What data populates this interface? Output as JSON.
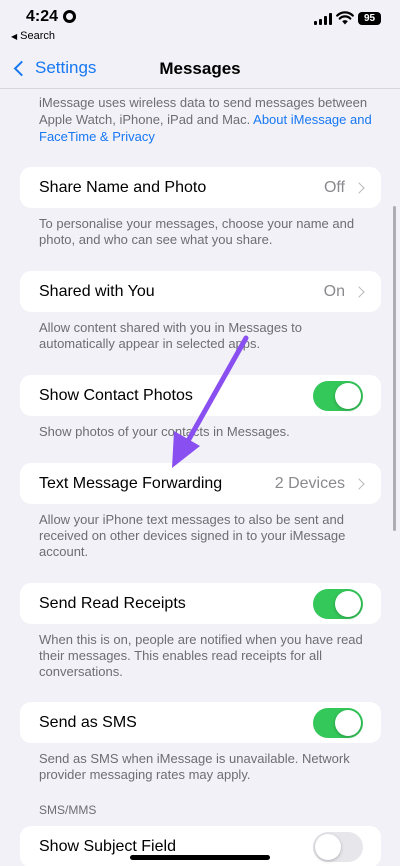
{
  "status_bar": {
    "time": "4:24",
    "back_app": "Search",
    "battery": "95"
  },
  "nav": {
    "back_label": "Settings",
    "title": "Messages"
  },
  "intro": {
    "text": "iMessage uses wireless data to send messages between Apple Watch, iPhone, iPad and Mac. ",
    "link": "About iMessage and FaceTime & Privacy"
  },
  "settings": {
    "share_name_photo": {
      "label": "Share Name and Photo",
      "value": "Off",
      "footer": "To personalise your messages, choose your name and photo, and who can see what you share."
    },
    "shared_with_you": {
      "label": "Shared with You",
      "value": "On",
      "footer": "Allow content shared with you in Messages to automatically appear in selected apps."
    },
    "show_contact_photos": {
      "label": "Show Contact Photos",
      "enabled": true,
      "footer": "Show photos of your contacts in Messages."
    },
    "text_message_forwarding": {
      "label": "Text Message Forwarding",
      "value": "2 Devices",
      "footer": "Allow your iPhone text messages to also be sent and received on other devices signed in to your iMessage account."
    },
    "send_read_receipts": {
      "label": "Send Read Receipts",
      "enabled": true,
      "footer": "When this is on, people are notified when you have read their messages. This enables read receipts for all conversations."
    },
    "send_as_sms": {
      "label": "Send as SMS",
      "enabled": true,
      "footer": "Send as SMS when iMessage is unavailable. Network provider messaging rates may apply."
    },
    "sms_mms_header": "SMS/MMS",
    "show_subject_field": {
      "label": "Show Subject Field",
      "enabled": false
    }
  },
  "colors": {
    "accent": "#1778f2",
    "toggle_on": "#34c759",
    "annotation_arrow": "#8a4ff0"
  },
  "icons": [
    "location-icon",
    "signal-icon",
    "wifi-icon",
    "battery-icon",
    "chevron-left-icon",
    "chevron-right-icon"
  ]
}
